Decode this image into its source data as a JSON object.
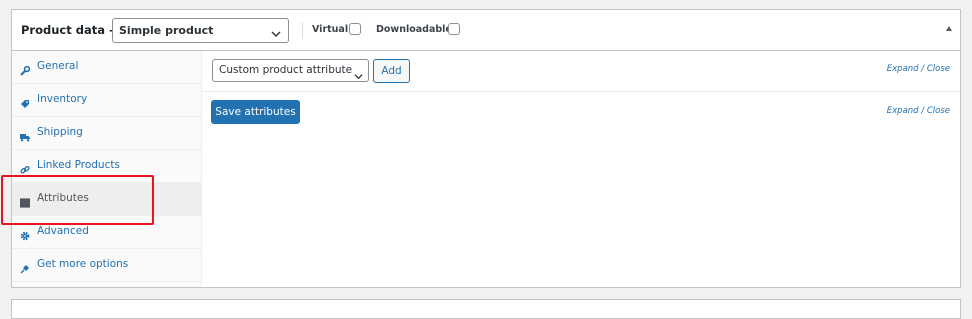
{
  "header": {
    "title": "Product data —",
    "product_type": "Simple product",
    "virtual_label": "Virtual:",
    "downloadable_label": "Downloadable:"
  },
  "sidebar": {
    "items": [
      {
        "label": "General",
        "icon": "wrench-icon"
      },
      {
        "label": "Inventory",
        "icon": "tag-icon"
      },
      {
        "label": "Shipping",
        "icon": "truck-icon"
      },
      {
        "label": "Linked Products",
        "icon": "link-icon"
      },
      {
        "label": "Attributes",
        "icon": "list-icon",
        "active": true
      },
      {
        "label": "Advanced",
        "icon": "gear-icon"
      },
      {
        "label": "Get more options",
        "icon": "plugin-icon"
      }
    ]
  },
  "main": {
    "attribute_select": "Custom product attribute",
    "add_label": "Add",
    "expand_close": "Expand / Close",
    "save_label": "Save attributes"
  },
  "colors": {
    "link": "#2271b1",
    "primary_button": "#2271b1",
    "highlight": "#e8141f"
  }
}
